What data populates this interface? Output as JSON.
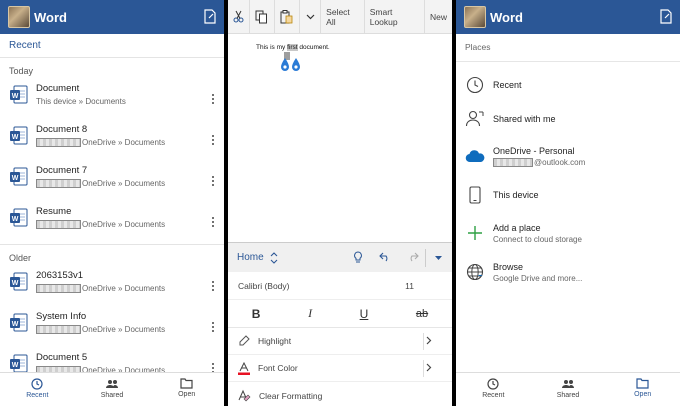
{
  "left": {
    "app_title": "Word",
    "section": "Recent",
    "groups": [
      {
        "label": "Today",
        "items": [
          {
            "name": "Document",
            "location": "This device » Documents",
            "redacted": false
          },
          {
            "name": "Document 8",
            "location": "OneDrive » Documents",
            "redacted": true
          },
          {
            "name": "Document 7",
            "location": "OneDrive » Documents",
            "redacted": true
          },
          {
            "name": "Resume",
            "location": "OneDrive » Documents",
            "redacted": true
          }
        ]
      },
      {
        "label": "Older",
        "items": [
          {
            "name": "2063153v1",
            "location": "OneDrive » Documents",
            "redacted": true
          },
          {
            "name": "System Info",
            "location": "OneDrive » Documents",
            "redacted": true
          },
          {
            "name": "Document 5",
            "location": "OneDrive » Documents",
            "redacted": true
          }
        ]
      }
    ],
    "nav": {
      "recent": "Recent",
      "shared": "Shared",
      "open": "Open"
    }
  },
  "middle": {
    "toolbar": {
      "select_all": "Select All",
      "smart_lookup": "Smart Lookup",
      "new": "New"
    },
    "doc_text": {
      "before": "This is my ",
      "selected": "first",
      "after": " document."
    },
    "ribbon": {
      "tab": "Home"
    },
    "font": {
      "name": "Calibri (Body)",
      "size": "11"
    },
    "format": {
      "bold": "B",
      "italic": "I",
      "underline": "U",
      "strike": "ab"
    },
    "options": {
      "highlight": "Highlight",
      "font_color": "Font Color",
      "clear_formatting": "Clear Formatting"
    }
  },
  "right": {
    "app_title": "Word",
    "section": "Places",
    "places": {
      "recent": "Recent",
      "shared": "Shared with me",
      "onedrive": "OneDrive - Personal",
      "onedrive_sub": "@outlook.com",
      "device": "This device",
      "add": "Add a place",
      "add_sub": "Connect to cloud storage",
      "browse": "Browse",
      "browse_sub": "Google Drive and more..."
    },
    "nav": {
      "recent": "Recent",
      "shared": "Shared",
      "open": "Open"
    }
  },
  "colors": {
    "accent": "#2b5796",
    "onedrive": "#0f6cbd",
    "add_green": "#2ea043",
    "font_red": "#e81123"
  }
}
